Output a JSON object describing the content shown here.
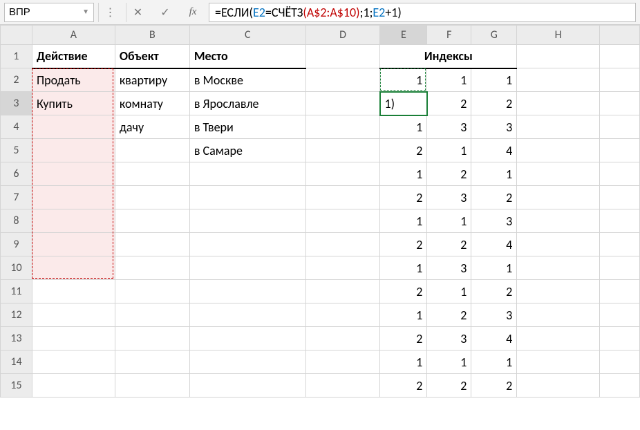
{
  "nameBox": {
    "value": "ВПР"
  },
  "formula": {
    "prefix": "=ЕСЛИ(",
    "ref1": "E2",
    "mid1": "=СЧЁТЗ",
    "openP": "(",
    "range": "A$2:A$10",
    "closeP": ")",
    "mid2": ";1;",
    "ref2": "E2",
    "suffix": "+1)"
  },
  "columns": [
    "A",
    "B",
    "C",
    "D",
    "E",
    "F",
    "G",
    "H",
    ""
  ],
  "headers": {
    "A": "Действие",
    "B": "Объект",
    "C": "Место",
    "EFG_merged": "Индексы"
  },
  "rows": [
    {
      "n": "1"
    },
    {
      "n": "2",
      "A": "Продать",
      "B": "квартиру",
      "C": "в Москве",
      "E": "1",
      "F": "1",
      "G": "1"
    },
    {
      "n": "3",
      "A": "Купить",
      "B": "комнату",
      "C": "в Ярославле",
      "E": "1)",
      "F": "2",
      "G": "2"
    },
    {
      "n": "4",
      "B": "дачу",
      "C": "в Твери",
      "E": "1",
      "F": "3",
      "G": "3"
    },
    {
      "n": "5",
      "C": "в Самаре",
      "E": "2",
      "F": "1",
      "G": "4"
    },
    {
      "n": "6",
      "E": "1",
      "F": "2",
      "G": "1"
    },
    {
      "n": "7",
      "E": "2",
      "F": "3",
      "G": "2"
    },
    {
      "n": "8",
      "E": "1",
      "F": "1",
      "G": "3"
    },
    {
      "n": "9",
      "E": "2",
      "F": "2",
      "G": "4"
    },
    {
      "n": "10",
      "E": "1",
      "F": "3",
      "G": "1"
    },
    {
      "n": "11",
      "E": "2",
      "F": "1",
      "G": "2"
    },
    {
      "n": "12",
      "E": "1",
      "F": "2",
      "G": "3"
    },
    {
      "n": "13",
      "E": "2",
      "F": "3",
      "G": "4"
    },
    {
      "n": "14",
      "E": "1",
      "F": "1",
      "G": "1"
    },
    {
      "n": "15",
      "E": "2",
      "F": "2",
      "G": "2"
    }
  ]
}
